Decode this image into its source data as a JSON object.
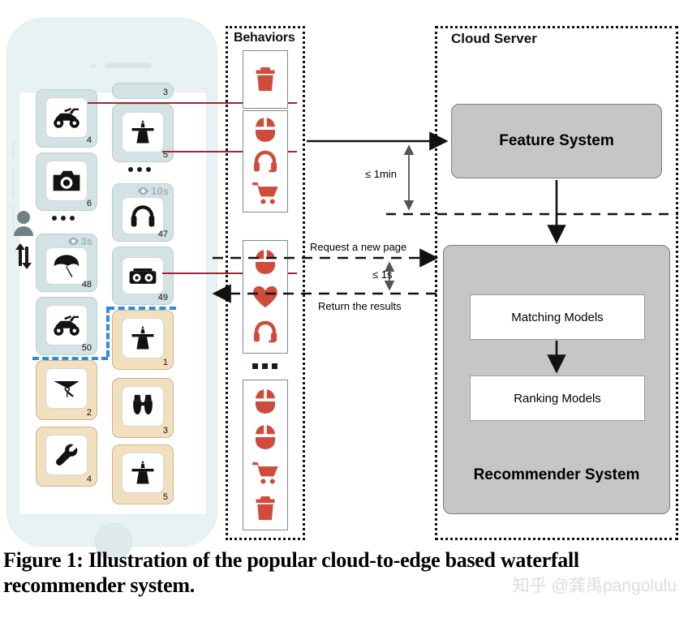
{
  "figure": {
    "caption": "Figure 1: Illustration of the popular cloud-to-edge based waterfall recommender system.",
    "watermark": "知乎 @龚禹pangolulu"
  },
  "phone": {
    "label": "smartphone-waterfall-feed",
    "scroll_indicator": "user-scroll-icon",
    "cards": [
      {
        "id": "c4",
        "column": "left",
        "index_label": "4",
        "icon": "quad-bike-icon",
        "state": "viewed",
        "dwell": null
      },
      {
        "id": "c3",
        "column": "right",
        "index_label": "3",
        "icon": null,
        "state": "partial",
        "dwell": null
      },
      {
        "id": "c5",
        "column": "right",
        "index_label": "5",
        "icon": "lighthouse-icon",
        "state": "viewed",
        "dwell": null
      },
      {
        "id": "c6",
        "column": "left",
        "index_label": "6",
        "icon": "camera-icon",
        "state": "viewed",
        "dwell": null
      },
      {
        "id": "c47",
        "column": "right",
        "index_label": "47",
        "icon": "headphones-icon",
        "state": "viewed",
        "dwell": "10s"
      },
      {
        "id": "c48",
        "column": "left",
        "index_label": "48",
        "icon": "beach-umbrella-icon",
        "state": "viewed",
        "dwell": "3s"
      },
      {
        "id": "c49",
        "column": "right",
        "index_label": "49",
        "icon": "boombox-icon",
        "state": "viewed",
        "dwell": null
      },
      {
        "id": "c50",
        "column": "left",
        "index_label": "50",
        "icon": "quad-bike-icon",
        "state": "viewed",
        "dwell": null
      },
      {
        "id": "n1",
        "column": "right",
        "index_label": "1",
        "icon": "lighthouse-icon",
        "state": "new",
        "dwell": null
      },
      {
        "id": "n2",
        "column": "left",
        "index_label": "2",
        "icon": "hang-glider-icon",
        "state": "new",
        "dwell": null
      },
      {
        "id": "n3",
        "column": "right",
        "index_label": "3",
        "icon": "binoculars-icon",
        "state": "new",
        "dwell": null
      },
      {
        "id": "n4",
        "column": "left",
        "index_label": "4",
        "icon": "wrench-icon",
        "state": "new",
        "dwell": null
      },
      {
        "id": "n5",
        "column": "right",
        "index_label": "5",
        "icon": "lighthouse-icon",
        "state": "new",
        "dwell": null
      }
    ],
    "ellipsis_label": "ellipsis-dots"
  },
  "behaviors": {
    "title": "Behaviors",
    "groups": [
      {
        "id": "g1",
        "icons": [
          "trash-icon"
        ]
      },
      {
        "id": "g2",
        "icons": [
          "mouse-click-icon",
          "headset-icon",
          "shopping-cart-icon"
        ]
      },
      {
        "id": "g3",
        "icons": [
          "mouse-click-icon",
          "heart-icon",
          "headset-icon"
        ]
      },
      {
        "id": "g4",
        "icons": [
          "mouse-click-icon",
          "mouse-click-icon",
          "shopping-cart-icon",
          "trash-icon"
        ]
      }
    ],
    "separator": "ellipsis-dots"
  },
  "cloud": {
    "title": "Cloud Server",
    "feature_system": "Feature System",
    "recommender_system": "Recommender System",
    "matching_models": "Matching Models",
    "ranking_models": "Ranking Models"
  },
  "annotations": {
    "latency_upload": "≤ 1min",
    "latency_request": "≤ 1s",
    "request_label": "Request a new page",
    "return_label": "Return the results"
  },
  "colors": {
    "accent_red": "#cf4b3c",
    "connector_red": "#a02536",
    "new_page_blue": "#2b8ce0",
    "card_viewed": "#d3e2e3",
    "card_new": "#f2dfbe",
    "cloud_gray": "#c6c6c6",
    "phone_body": "#e8f2f4"
  }
}
